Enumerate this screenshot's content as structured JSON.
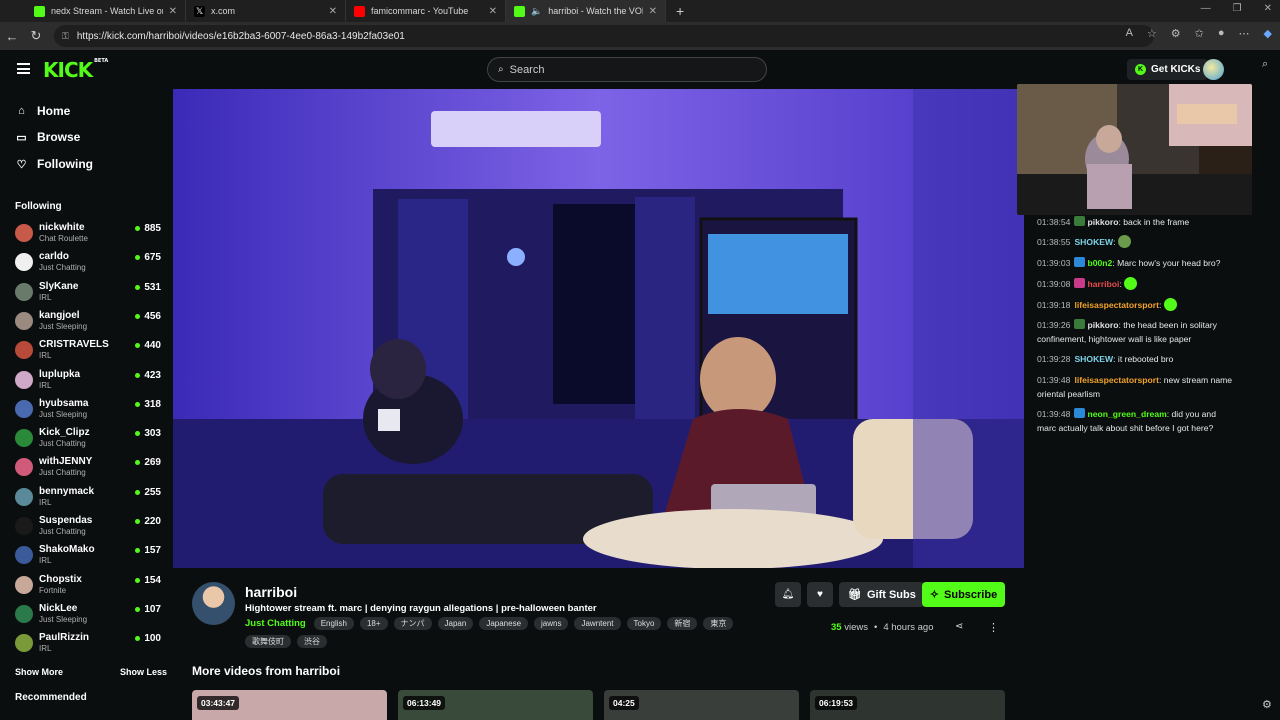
{
  "browser": {
    "tabs": [
      {
        "title": "nedx Stream - Watch Live on",
        "favicon_color": "#53fc18",
        "active": false
      },
      {
        "title": "x.com",
        "favicon_color": "#000000",
        "active": false
      },
      {
        "title": "famicommarc - YouTube",
        "favicon_color": "#ff0000",
        "active": false
      },
      {
        "title": "harriboi - Watch the VOD on",
        "favicon_color": "#53fc18",
        "active": true
      }
    ],
    "url": "https://kick.com/harriboi/videos/e16b2ba3-6007-4ee0-86a3-149b2fa03e01"
  },
  "header": {
    "logo": "KICK",
    "logo_badge": "BETA",
    "search_placeholder": "Search",
    "get_kicks": "Get KICKs"
  },
  "sidebar": {
    "nav": [
      {
        "label": "Home",
        "icon": "home-icon"
      },
      {
        "label": "Browse",
        "icon": "browse-icon"
      },
      {
        "label": "Following",
        "icon": "heart-icon"
      }
    ],
    "following_title": "Following",
    "channels": [
      {
        "name": "nickwhite",
        "category": "Chat Roulette",
        "viewers": "885",
        "color": "#c85a4a"
      },
      {
        "name": "carldo",
        "category": "Just Chatting",
        "viewers": "675",
        "color": "#f0f0f0"
      },
      {
        "name": "SlyKane",
        "category": "IRL",
        "viewers": "531",
        "color": "#6a7a6a"
      },
      {
        "name": "kangjoel",
        "category": "Just Sleeping",
        "viewers": "456",
        "color": "#9a8a80"
      },
      {
        "name": "CRISTRAVELS",
        "category": "IRL",
        "viewers": "440",
        "color": "#b84a3a"
      },
      {
        "name": "luplupka",
        "category": "IRL",
        "viewers": "423",
        "color": "#d0a8c8"
      },
      {
        "name": "hyubsama",
        "category": "Just Sleeping",
        "viewers": "318",
        "color": "#4a6ab0"
      },
      {
        "name": "Kick_Clipz",
        "category": "Just Chatting",
        "viewers": "303",
        "color": "#2a8a3a"
      },
      {
        "name": "withJENNY",
        "category": "Just Chatting",
        "viewers": "269",
        "color": "#d05a7a"
      },
      {
        "name": "bennymack",
        "category": "IRL",
        "viewers": "255",
        "color": "#5a8a9a"
      },
      {
        "name": "Suspendas",
        "category": "Just Chatting",
        "viewers": "220",
        "color": "#1a1a1a"
      },
      {
        "name": "ShakoMako",
        "category": "IRL",
        "viewers": "157",
        "color": "#3a5a9a"
      },
      {
        "name": "Chopstix",
        "category": "Fortnite",
        "viewers": "154",
        "color": "#c8a898"
      },
      {
        "name": "NickLee",
        "category": "Just Sleeping",
        "viewers": "107",
        "color": "#2a7a4a"
      },
      {
        "name": "PaulRizzin",
        "category": "IRL",
        "viewers": "100",
        "color": "#7a9a3a"
      }
    ],
    "show_more": "Show More",
    "show_less": "Show Less",
    "recommended": "Recommended"
  },
  "video_info": {
    "channel": "harriboi",
    "title": "Hightower stream ft. marc | denying raygun allegations | pre-halloween banter",
    "category": "Just Chatting",
    "tags": [
      "English",
      "18+",
      "ナンパ",
      "Japan",
      "Japanese",
      "jawns",
      "Jawntent",
      "Tokyo",
      "新宿",
      "東京",
      "歌舞伎町",
      "渋谷"
    ],
    "gift_subs": "Gift Subs",
    "subscribe": "Subscribe",
    "views_count": "35",
    "views_label": "views",
    "separator": "•",
    "age": "4 hours ago"
  },
  "more_videos": {
    "title": "More videos from harriboi",
    "items": [
      {
        "duration": "03:43:47",
        "color": "#c8a8a8"
      },
      {
        "duration": "06:13:49",
        "color": "#3a4a3a"
      },
      {
        "duration": "04:25",
        "color": "#3a3e3a"
      },
      {
        "duration": "06:19:53",
        "color": "#2e3430"
      }
    ]
  },
  "chat": [
    {
      "time": "01:38:54",
      "badge": "#3a7a3a",
      "user": "pikkoro",
      "user_color": "#e0e0e0",
      "text": "back in the frame"
    },
    {
      "time": "01:38:55",
      "badge": "",
      "user": "SHOKEW",
      "user_color": "#7fd3e8",
      "text": "",
      "emote": "#6a9a4a"
    },
    {
      "time": "01:39:03",
      "badge": "#2a8ad8",
      "user": "b00n2",
      "user_color": "#53fc18",
      "text": "Marc how's your head bro?"
    },
    {
      "time": "01:39:08",
      "badge": "#c83a8a",
      "user": "harriboi",
      "user_color": "#e84a4a",
      "text": "",
      "emote": "#53fc18"
    },
    {
      "time": "01:39:18",
      "badge": "",
      "user": "lifeisaspectatorsport",
      "user_color": "#f2a32a",
      "text": "",
      "emote": "#53fc18"
    },
    {
      "time": "01:39:26",
      "badge": "#3a7a3a",
      "user": "pikkoro",
      "user_color": "#e0e0e0",
      "text": "the head been in solitary confinement, hightower wall is like paper"
    },
    {
      "time": "01:39:28",
      "badge": "",
      "user": "SHOKEW",
      "user_color": "#7fd3e8",
      "text": "it rebooted bro"
    },
    {
      "time": "01:39:48",
      "badge": "",
      "user": "lifeisaspectatorsport",
      "user_color": "#f2a32a",
      "text": "new stream name oriental pearlism"
    },
    {
      "time": "01:39:48",
      "badge": "#2a8ad8",
      "user": "neon_green_dream",
      "user_color": "#53fc18",
      "text": "did you and marc actually talk about shit before I got here?"
    }
  ]
}
